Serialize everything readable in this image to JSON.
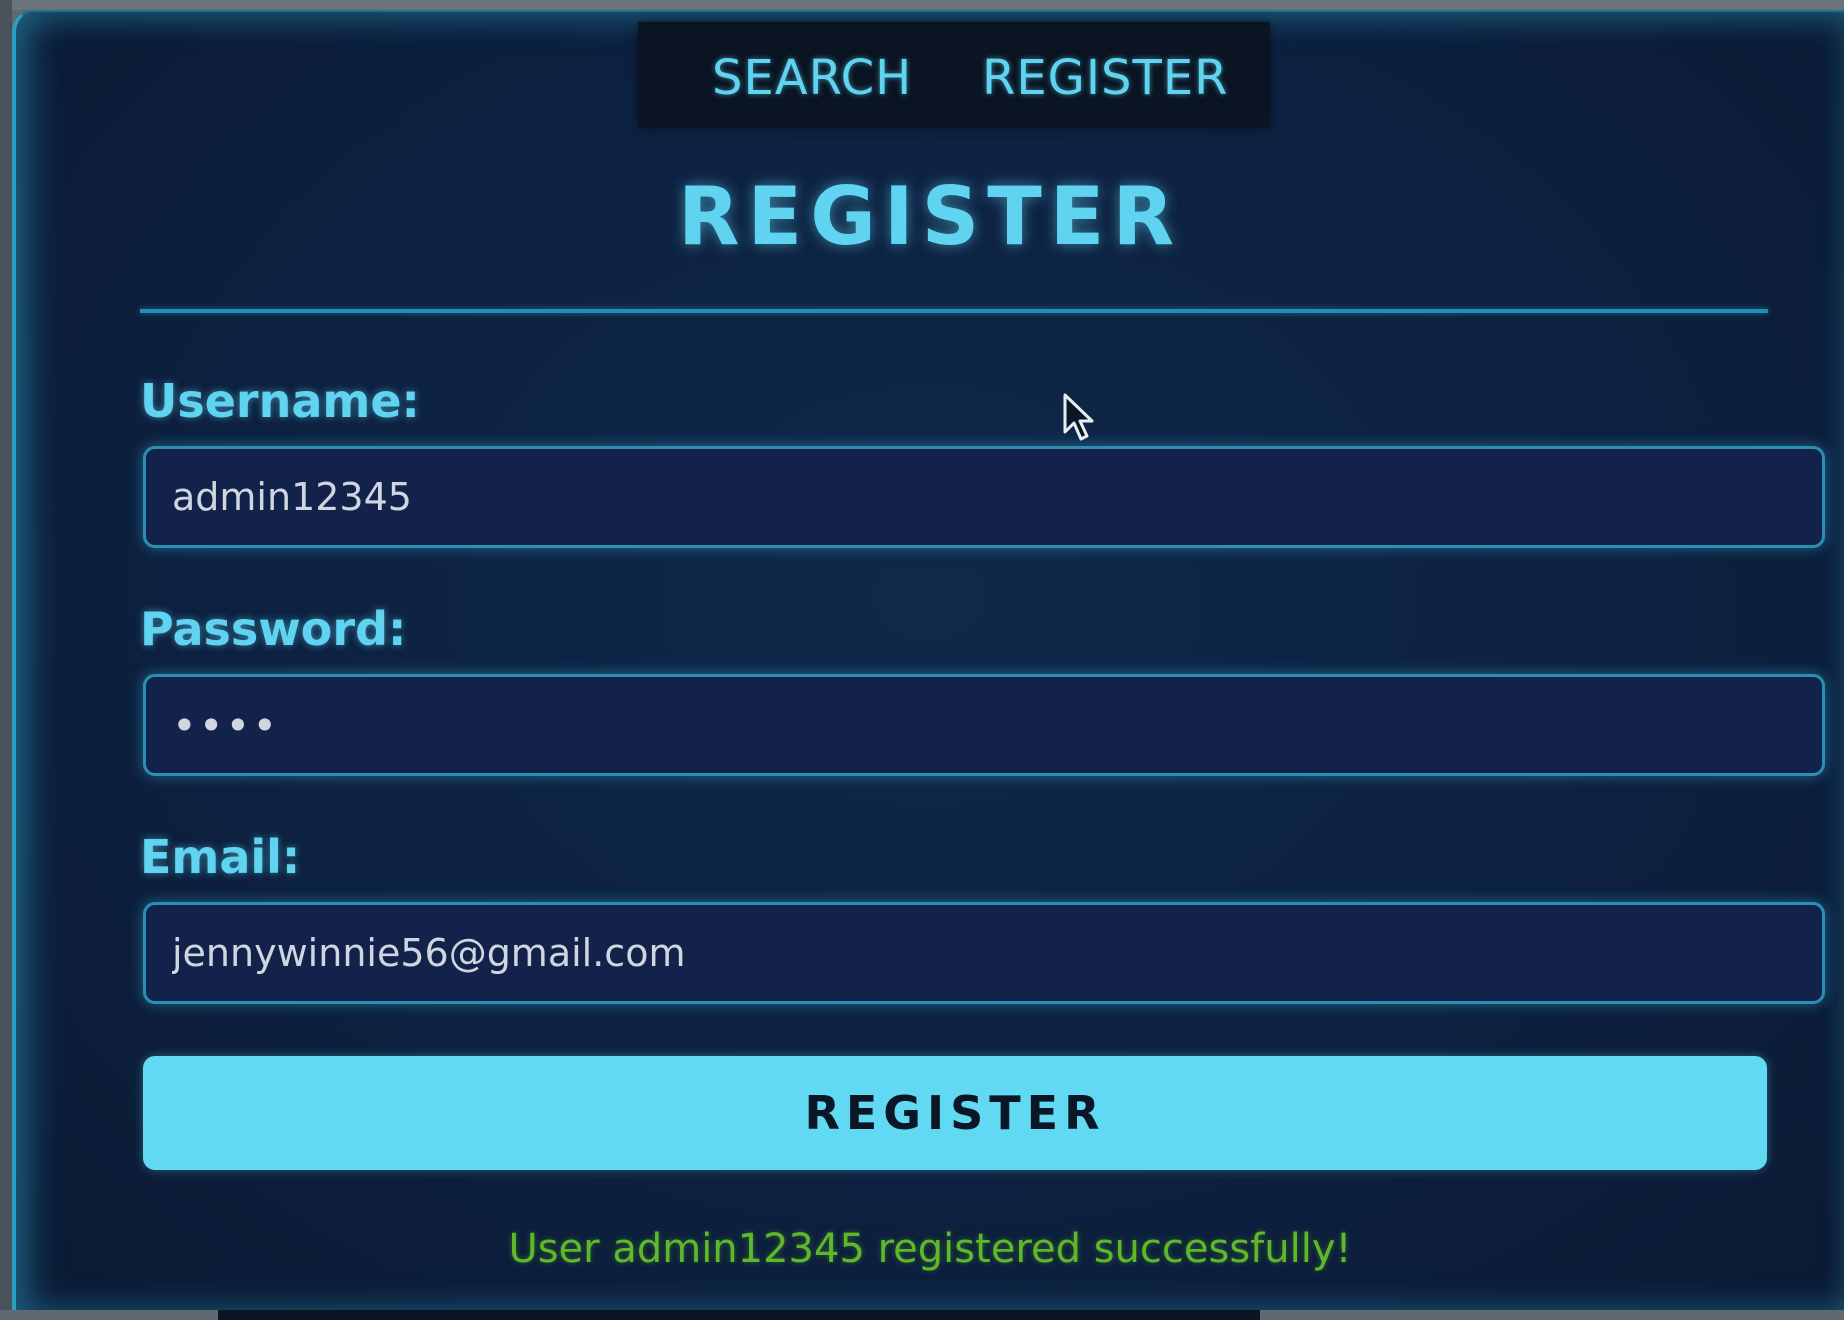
{
  "nav": {
    "search_label": "SEARCH",
    "register_label": "REGISTER"
  },
  "page": {
    "title": "REGISTER"
  },
  "form": {
    "username_label": "Username:",
    "username_value": "admin12345",
    "password_label": "Password:",
    "password_value": "••••",
    "email_label": "Email:",
    "email_value": "jennywinnie56@gmail.com",
    "submit_label": "REGISTER"
  },
  "status": {
    "message": "User admin12345 registered successfully!"
  },
  "colors": {
    "accent": "#5fd3f0",
    "button": "#62d9f2",
    "background": "#0d2140",
    "success": "#5fb82a"
  },
  "icons": {
    "cursor": "mouse-pointer-icon"
  }
}
